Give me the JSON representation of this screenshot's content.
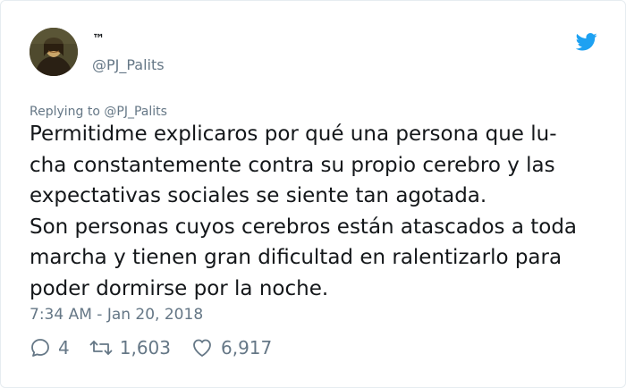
{
  "user": {
    "display_name": "™",
    "handle": "@PJ_Palits"
  },
  "icons": {
    "brand": "twitter-bird-icon",
    "reply": "reply-bubble-icon",
    "retweet": "retweet-icon",
    "like": "heart-icon"
  },
  "colors": {
    "brand": "#1da1f2",
    "secondary_text": "#657786",
    "primary_text": "#14171a"
  },
  "reply_context": {
    "prefix": "Replying to",
    "mention": "@PJ_Palits"
  },
  "tweet": {
    "lines": [
      "Permitidme explicaros por qué una persona que lu-",
      "cha constantemente contra su propio cerebro y las",
      "expectativas sociales se siente tan agotada.",
      "Son personas cuyos cerebros están atascados a toda",
      "marcha y tienen gran dificultad en ralentizarlo para",
      "poder dormirse por la noche."
    ]
  },
  "timestamp": "7:34 AM - Jan 20, 2018",
  "stats": {
    "replies": "4",
    "retweets": "1,603",
    "likes": "6,917"
  }
}
